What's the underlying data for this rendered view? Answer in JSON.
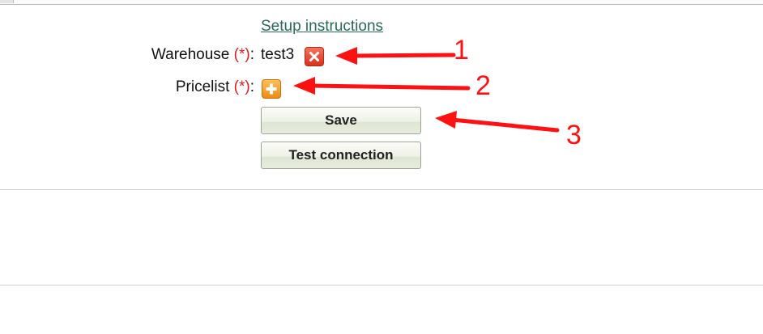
{
  "form": {
    "setup_link": "Setup instructions",
    "warehouse": {
      "label": "Warehouse",
      "required_mark": "(*)",
      "colon": ":",
      "value": "test3",
      "action_icon": "remove-icon"
    },
    "pricelist": {
      "label": "Pricelist",
      "required_mark": "(*)",
      "colon": ":",
      "action_icon": "add-icon"
    },
    "save_label": "Save",
    "test_connection_label": "Test connection"
  },
  "annotations": {
    "numbers": [
      "1",
      "2",
      "3"
    ],
    "color": "#ff1111"
  },
  "colors": {
    "link": "#2a6a55",
    "required": "#e01e1e",
    "remove_icon": "#e44a35",
    "add_icon": "#f5a02e"
  }
}
